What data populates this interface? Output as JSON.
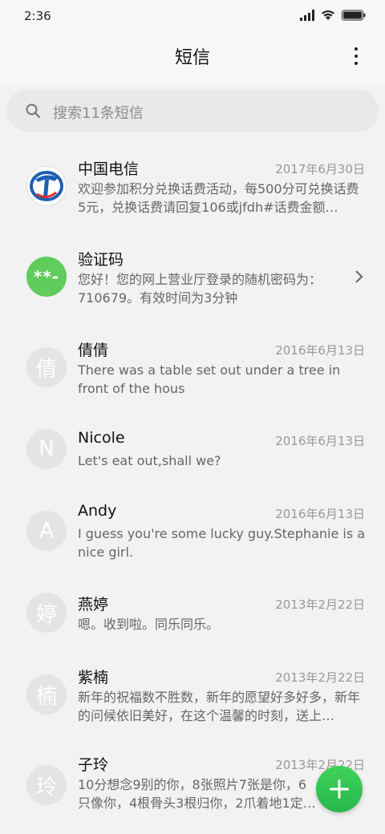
{
  "status": {
    "time": "2:36"
  },
  "header": {
    "title": "短信"
  },
  "search": {
    "placeholder": "搜索11条短信"
  },
  "conversations": [
    {
      "name": "中国电信",
      "date": "2017年6月30日",
      "preview": "欢迎参加积分兑换话费活动，每500分可兑换话费5元，兑换话费请回复106或jfdh#话费金额…",
      "avatar_text": "",
      "avatar_type": "china-telecom-logo"
    },
    {
      "name": "验证码",
      "date": "",
      "preview": "您好！您的网上营业厅登录的随机密码为：710679。有效时间为3分钟",
      "avatar_text": "**-",
      "avatar_type": "verification"
    },
    {
      "name": "倩倩",
      "date": "2016年6月13日",
      "preview": "There was a table set out under a tree in front of the hous",
      "avatar_text": "倩",
      "avatar_type": "initial"
    },
    {
      "name": "Nicole",
      "date": "2016年6月13日",
      "preview": "Let's eat out,shall we?",
      "avatar_text": "N",
      "avatar_type": "initial"
    },
    {
      "name": "Andy",
      "date": "2016年6月13日",
      "preview": "I guess you're some lucky guy.Stephanie is a nice girl.",
      "avatar_text": "A",
      "avatar_type": "initial"
    },
    {
      "name": "燕婷",
      "date": "2013年2月22日",
      "preview": "嗯。收到啦。同乐同乐。",
      "avatar_text": "婷",
      "avatar_type": "initial"
    },
    {
      "name": "紫楠",
      "date": "2013年2月22日",
      "preview": "新年的祝福数不胜数，新年的愿望好多好多，新年的问候依旧美好，在这个温馨的时刻，送上…",
      "avatar_text": "楠",
      "avatar_type": "initial"
    },
    {
      "name": "子玲",
      "date": "2013年2月22日",
      "preview": "10分想念9别的你，8张照片7张是你，6只像你，4根骨头3根归你，2爪着地1定是…",
      "avatar_text": "玲",
      "avatar_type": "initial"
    }
  ],
  "colors": {
    "accent": "#2dbf4f",
    "verification": "#5fcc5b",
    "avatar_gray": "#e4e4e4"
  }
}
